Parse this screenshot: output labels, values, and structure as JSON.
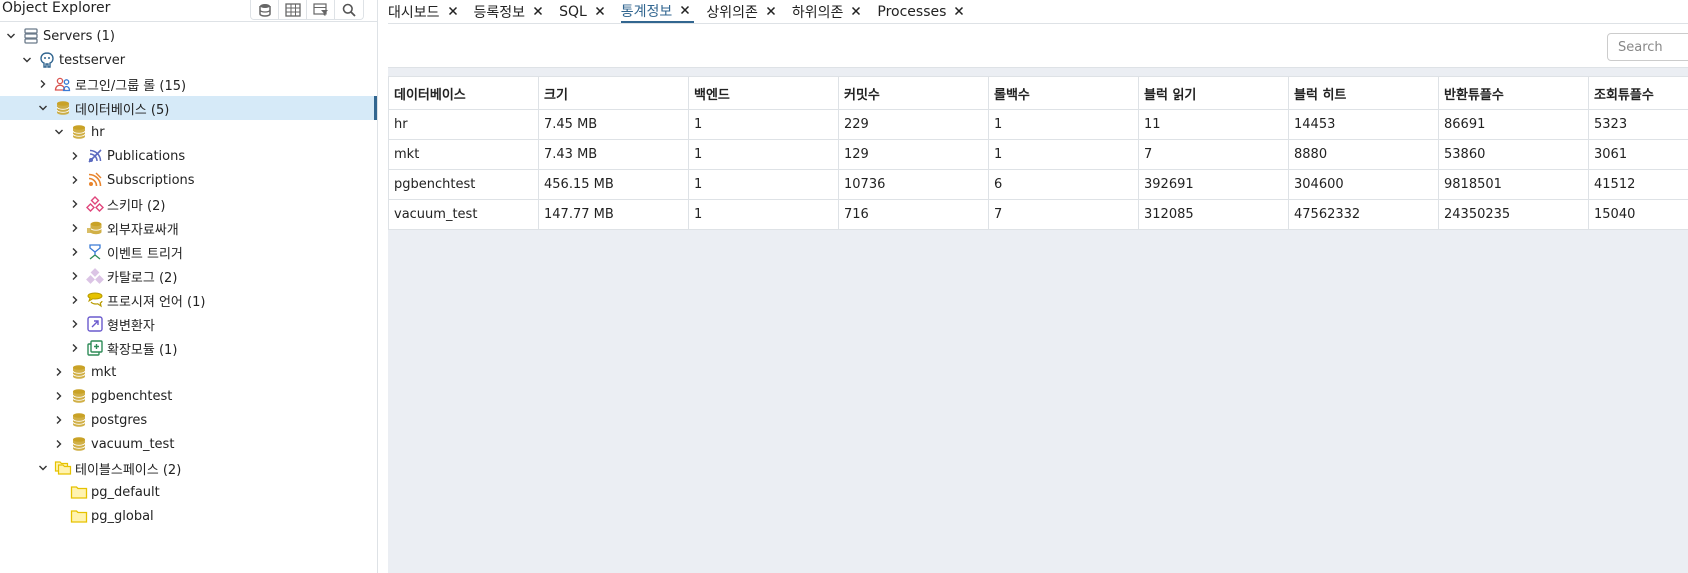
{
  "object_explorer": {
    "title": "Object Explorer",
    "tree": [
      {
        "label": "Servers (1)",
        "level": 0,
        "expanded": true,
        "icon": "servers-icon",
        "color": "#6b7a8a"
      },
      {
        "label": "testserver",
        "level": 1,
        "expanded": true,
        "icon": "server-icon",
        "color": "#326690"
      },
      {
        "label": "로그인/그룹 롤 (15)",
        "level": 2,
        "expanded": false,
        "icon": "login-roles-icon",
        "color": "#d9534f"
      },
      {
        "label": "데이터베이스 (5)",
        "level": 2,
        "expanded": true,
        "icon": "databases-icon",
        "color": "#c9a227",
        "selected": true
      },
      {
        "label": "hr",
        "level": 3,
        "expanded": true,
        "icon": "database-icon",
        "color": "#c9a227"
      },
      {
        "label": "Publications",
        "level": 4,
        "expanded": false,
        "icon": "publication-icon",
        "color": "#5b6abf"
      },
      {
        "label": "Subscriptions",
        "level": 4,
        "expanded": false,
        "icon": "subscription-icon",
        "color": "#e8842c"
      },
      {
        "label": "스키마 (2)",
        "level": 4,
        "expanded": false,
        "icon": "schema-icon",
        "color": "#e0457b"
      },
      {
        "label": "외부자료싸개",
        "level": 4,
        "expanded": false,
        "icon": "foreign-data-wrapper-icon",
        "color": "#c9a227"
      },
      {
        "label": "이벤트 트리거",
        "level": 4,
        "expanded": false,
        "icon": "event-trigger-icon",
        "color": "#3a7bd5"
      },
      {
        "label": "카탈로그 (2)",
        "level": 4,
        "expanded": false,
        "icon": "catalog-icon",
        "color": "#9b59b6"
      },
      {
        "label": "프로시져 언어 (1)",
        "level": 4,
        "expanded": false,
        "icon": "language-icon",
        "color": "#e6c200"
      },
      {
        "label": "형변환자",
        "level": 4,
        "expanded": false,
        "icon": "cast-icon",
        "color": "#6a5acd"
      },
      {
        "label": "확장모듈 (1)",
        "level": 4,
        "expanded": false,
        "icon": "extension-icon",
        "color": "#2e8b57"
      },
      {
        "label": "mkt",
        "level": 3,
        "expanded": false,
        "icon": "database-icon",
        "color": "#c9a227"
      },
      {
        "label": "pgbenchtest",
        "level": 3,
        "expanded": false,
        "icon": "database-icon",
        "color": "#c9a227"
      },
      {
        "label": "postgres",
        "level": 3,
        "expanded": false,
        "icon": "database-icon",
        "color": "#c9a227"
      },
      {
        "label": "vacuum_test",
        "level": 3,
        "expanded": false,
        "icon": "database-icon",
        "color": "#c9a227"
      },
      {
        "label": "테이블스페이스 (2)",
        "level": 2,
        "expanded": true,
        "icon": "tablespaces-icon",
        "color": "#e6c200"
      },
      {
        "label": "pg_default",
        "level": 3,
        "leaf": true,
        "icon": "tablespace-icon",
        "color": "#e6c200"
      },
      {
        "label": "pg_global",
        "level": 3,
        "leaf": true,
        "icon": "tablespace-icon",
        "color": "#e6c200"
      }
    ]
  },
  "tabs": [
    {
      "label": "대시보드",
      "active": false
    },
    {
      "label": "등록정보",
      "active": false
    },
    {
      "label": "SQL",
      "active": false
    },
    {
      "label": "통계정보",
      "active": true
    },
    {
      "label": "상위의존",
      "active": false
    },
    {
      "label": "하위의존",
      "active": false
    },
    {
      "label": "Processes",
      "active": false
    }
  ],
  "search": {
    "placeholder": "Search"
  },
  "stats_table": {
    "columns": [
      "데이터베이스",
      "크기",
      "백엔드",
      "커밋수",
      "롤백수",
      "블럭 읽기",
      "블럭 히트",
      "반환튜플수",
      "조회튜플수"
    ],
    "rows": [
      [
        "hr",
        "7.45 MB",
        "1",
        "229",
        "1",
        "11",
        "14453",
        "86691",
        "5323"
      ],
      [
        "mkt",
        "7.43 MB",
        "1",
        "129",
        "1",
        "7",
        "8880",
        "53860",
        "3061"
      ],
      [
        "pgbenchtest",
        "456.15 MB",
        "1",
        "10736",
        "6",
        "392691",
        "304600",
        "9818501",
        "41512"
      ],
      [
        "vacuum_test",
        "147.77 MB",
        "1",
        "716",
        "7",
        "312085",
        "47562332",
        "24350235",
        "15040"
      ]
    ]
  },
  "colors": {
    "accent": "#326690",
    "selected_bg": "#d6eaf8",
    "content_bg": "#ebeef3"
  }
}
